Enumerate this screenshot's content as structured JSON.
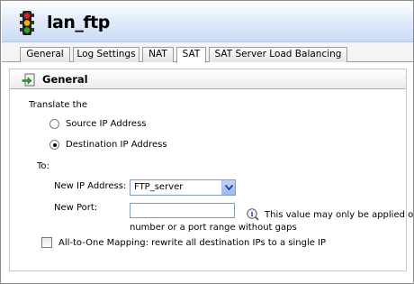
{
  "window": {
    "title": "lan_ftp"
  },
  "tabs": [
    {
      "label": "General"
    },
    {
      "label": "Log Settings"
    },
    {
      "label": "NAT"
    },
    {
      "label": "SAT"
    },
    {
      "label": "SAT Server Load Balancing"
    }
  ],
  "active_tab": "SAT",
  "section": {
    "title": "General",
    "translate_label": "Translate the",
    "radio_source": {
      "label": "Source IP Address",
      "checked": false
    },
    "radio_destination": {
      "label": "Destination IP Address",
      "checked": true
    },
    "to_label": "To:",
    "new_ip": {
      "label": "New IP Address:",
      "value": "FTP_server"
    },
    "new_port": {
      "label": "New Port:",
      "value": "",
      "hint_line1": "This value may only be applied on",
      "hint_line2": "number or a port range without gaps"
    },
    "all_to_one": {
      "label": "All-to-One Mapping: rewrite all destination IPs to a single IP",
      "checked": false
    }
  },
  "colors": {
    "header_top": "#ffffff",
    "header_bottom": "#c9dbf5",
    "input_border": "#7f9db9"
  },
  "icons": {
    "title": "traffic-light-icon",
    "section": "arrow-in-icon",
    "hint": "info-icon"
  }
}
